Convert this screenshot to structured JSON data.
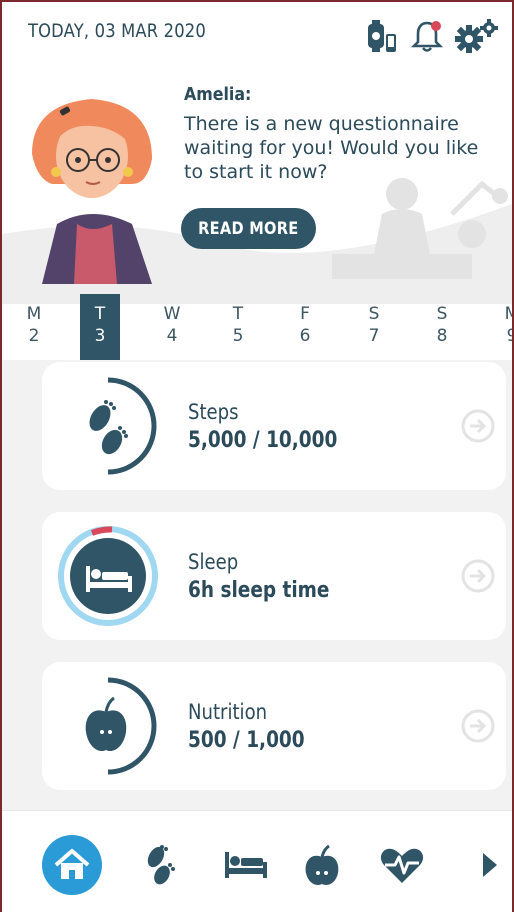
{
  "header": {
    "date": "TODAY, 03 MAR 2020",
    "icons": [
      "watch-phone-icon",
      "bell-icon",
      "gears-icon"
    ]
  },
  "assistant": {
    "name": "Amelia:",
    "message_lines": [
      "There is a new questionnaire",
      "waiting for you! Would you like",
      "to start it now?"
    ],
    "button_label": "READ MORE"
  },
  "week": {
    "days": [
      {
        "letter": "M",
        "date": "2"
      },
      {
        "letter": "T",
        "date": "3",
        "active": true
      },
      {
        "letter": "W",
        "date": "4"
      },
      {
        "letter": "T",
        "date": "5"
      },
      {
        "letter": "F",
        "date": "6"
      },
      {
        "letter": "S",
        "date": "7"
      },
      {
        "letter": "S",
        "date": "8"
      },
      {
        "letter": "M",
        "date": "9"
      }
    ]
  },
  "cards": [
    {
      "title": "Steps",
      "value": "5,000 / 10,000",
      "icon": "footprints-icon"
    },
    {
      "title": "Sleep",
      "value": "6h sleep time",
      "icon": "bed-icon"
    },
    {
      "title": "Nutrition",
      "value": "500 / 1,000",
      "icon": "apple-icon"
    }
  ],
  "bottom_nav": {
    "items": [
      "home-icon",
      "footprints-icon",
      "bed-icon",
      "apple-icon",
      "heart-pulse-icon",
      "next-arrow-icon"
    ]
  },
  "colors": {
    "primary": "#2f5566",
    "home_active": "#2a9bd6",
    "sleep_ring": "#9fd8f0",
    "sleep_alert": "#d9485a",
    "card_bg": "#ffffff",
    "panel_bg": "#f2f2f2"
  }
}
